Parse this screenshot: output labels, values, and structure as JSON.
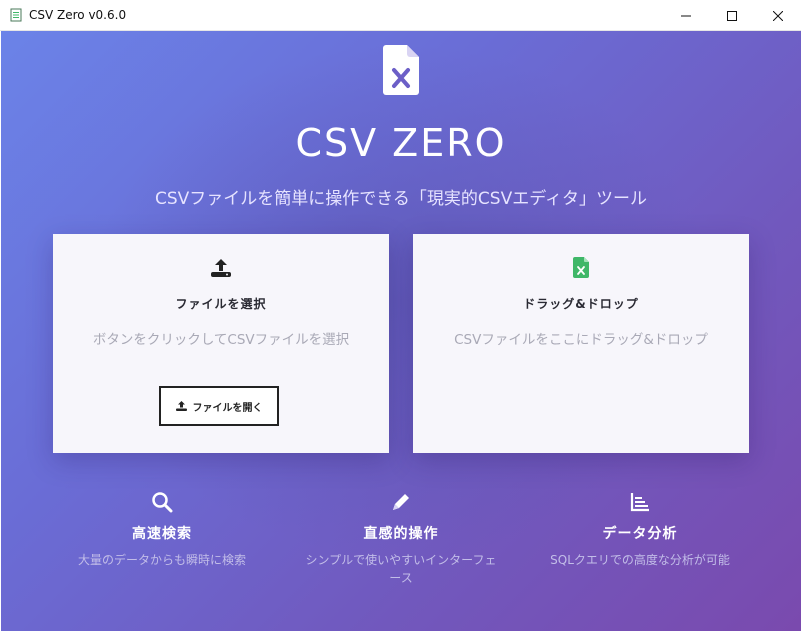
{
  "window": {
    "title": "CSV Zero v0.6.0"
  },
  "app": {
    "brand": "CSV ZERO",
    "tagline": "CSVファイルを簡単に操作できる「現実的CSVエディタ」ツール"
  },
  "cards": {
    "select": {
      "title": "ファイルを選択",
      "description": "ボタンをクリックしてCSVファイルを選択",
      "button_label": "ファイルを開く",
      "icon": "upload-icon"
    },
    "drop": {
      "title": "ドラッグ&ドロップ",
      "description": "CSVファイルをここにドラッグ&ドロップ",
      "icon": "csv-file-icon"
    }
  },
  "features": [
    {
      "icon": "search-icon",
      "title": "高速検索",
      "description": "大量のデータからも瞬時に検索"
    },
    {
      "icon": "pencil-icon",
      "title": "直感的操作",
      "description": "シンプルで使いやすいインターフェース"
    },
    {
      "icon": "bar-chart-icon",
      "title": "データ分析",
      "description": "SQLクエリでの高度な分析が可能"
    }
  ],
  "colors": {
    "gradient_start": "#6b83e8",
    "gradient_end": "#7a4aae",
    "csv_green": "#3fb768"
  }
}
